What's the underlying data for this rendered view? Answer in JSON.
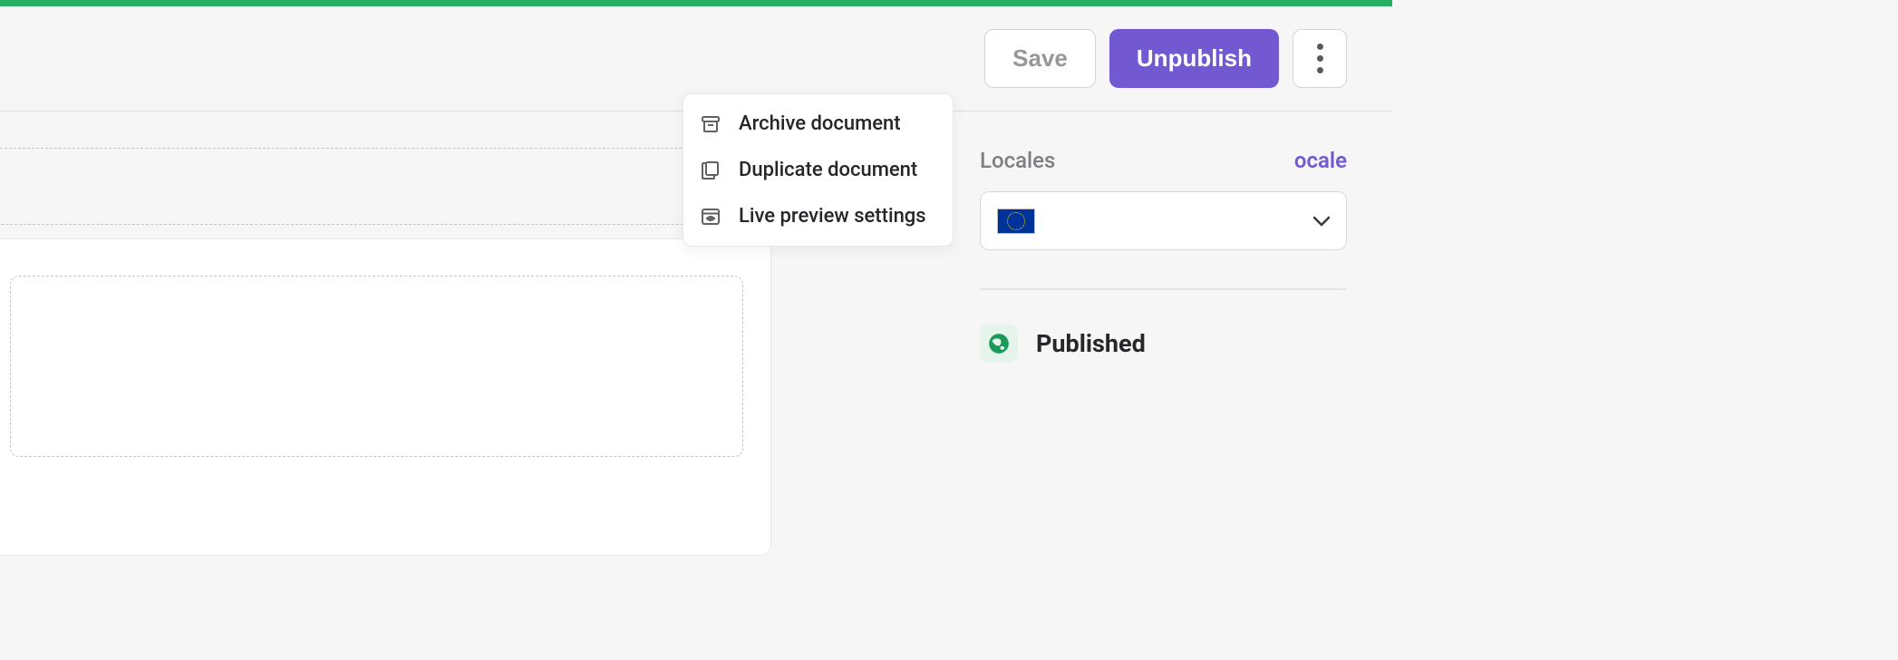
{
  "toolbar": {
    "save_label": "Save",
    "unpublish_label": "Unpublish"
  },
  "menu": {
    "items": [
      {
        "label": "Archive document"
      },
      {
        "label": "Duplicate document"
      },
      {
        "label": "Live preview settings"
      }
    ]
  },
  "sidebar": {
    "locales_label": "Locales",
    "configure_locale_label": "ocale",
    "status_label": "Published"
  }
}
